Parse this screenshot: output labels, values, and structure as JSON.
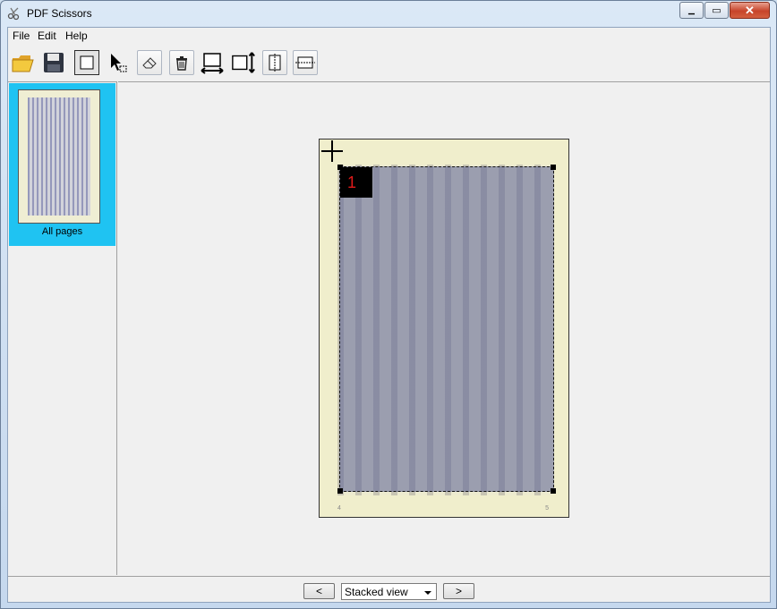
{
  "window": {
    "title": "PDF Scissors",
    "close_glyph": "✕",
    "minimize_glyph": "▁",
    "maximize_glyph": "▭"
  },
  "menubar": {
    "items": [
      "File",
      "Edit",
      "Help"
    ]
  },
  "toolbar": {
    "icons": [
      "open-folder-icon",
      "save-disk-icon",
      "select-rectangle-icon",
      "select-arrow-icon",
      "eraser-icon",
      "trash-icon",
      "equal-width-icon",
      "equal-height-icon",
      "split-vertical-icon",
      "split-horizontal-icon"
    ]
  },
  "sidebar": {
    "thumbnails": [
      {
        "label": "All pages"
      }
    ]
  },
  "workspace": {
    "selection_label": "1",
    "page_numbers": [
      "4",
      "5"
    ]
  },
  "statusbar": {
    "prev_label": "<",
    "next_label": ">",
    "view_mode": "Stacked view"
  }
}
